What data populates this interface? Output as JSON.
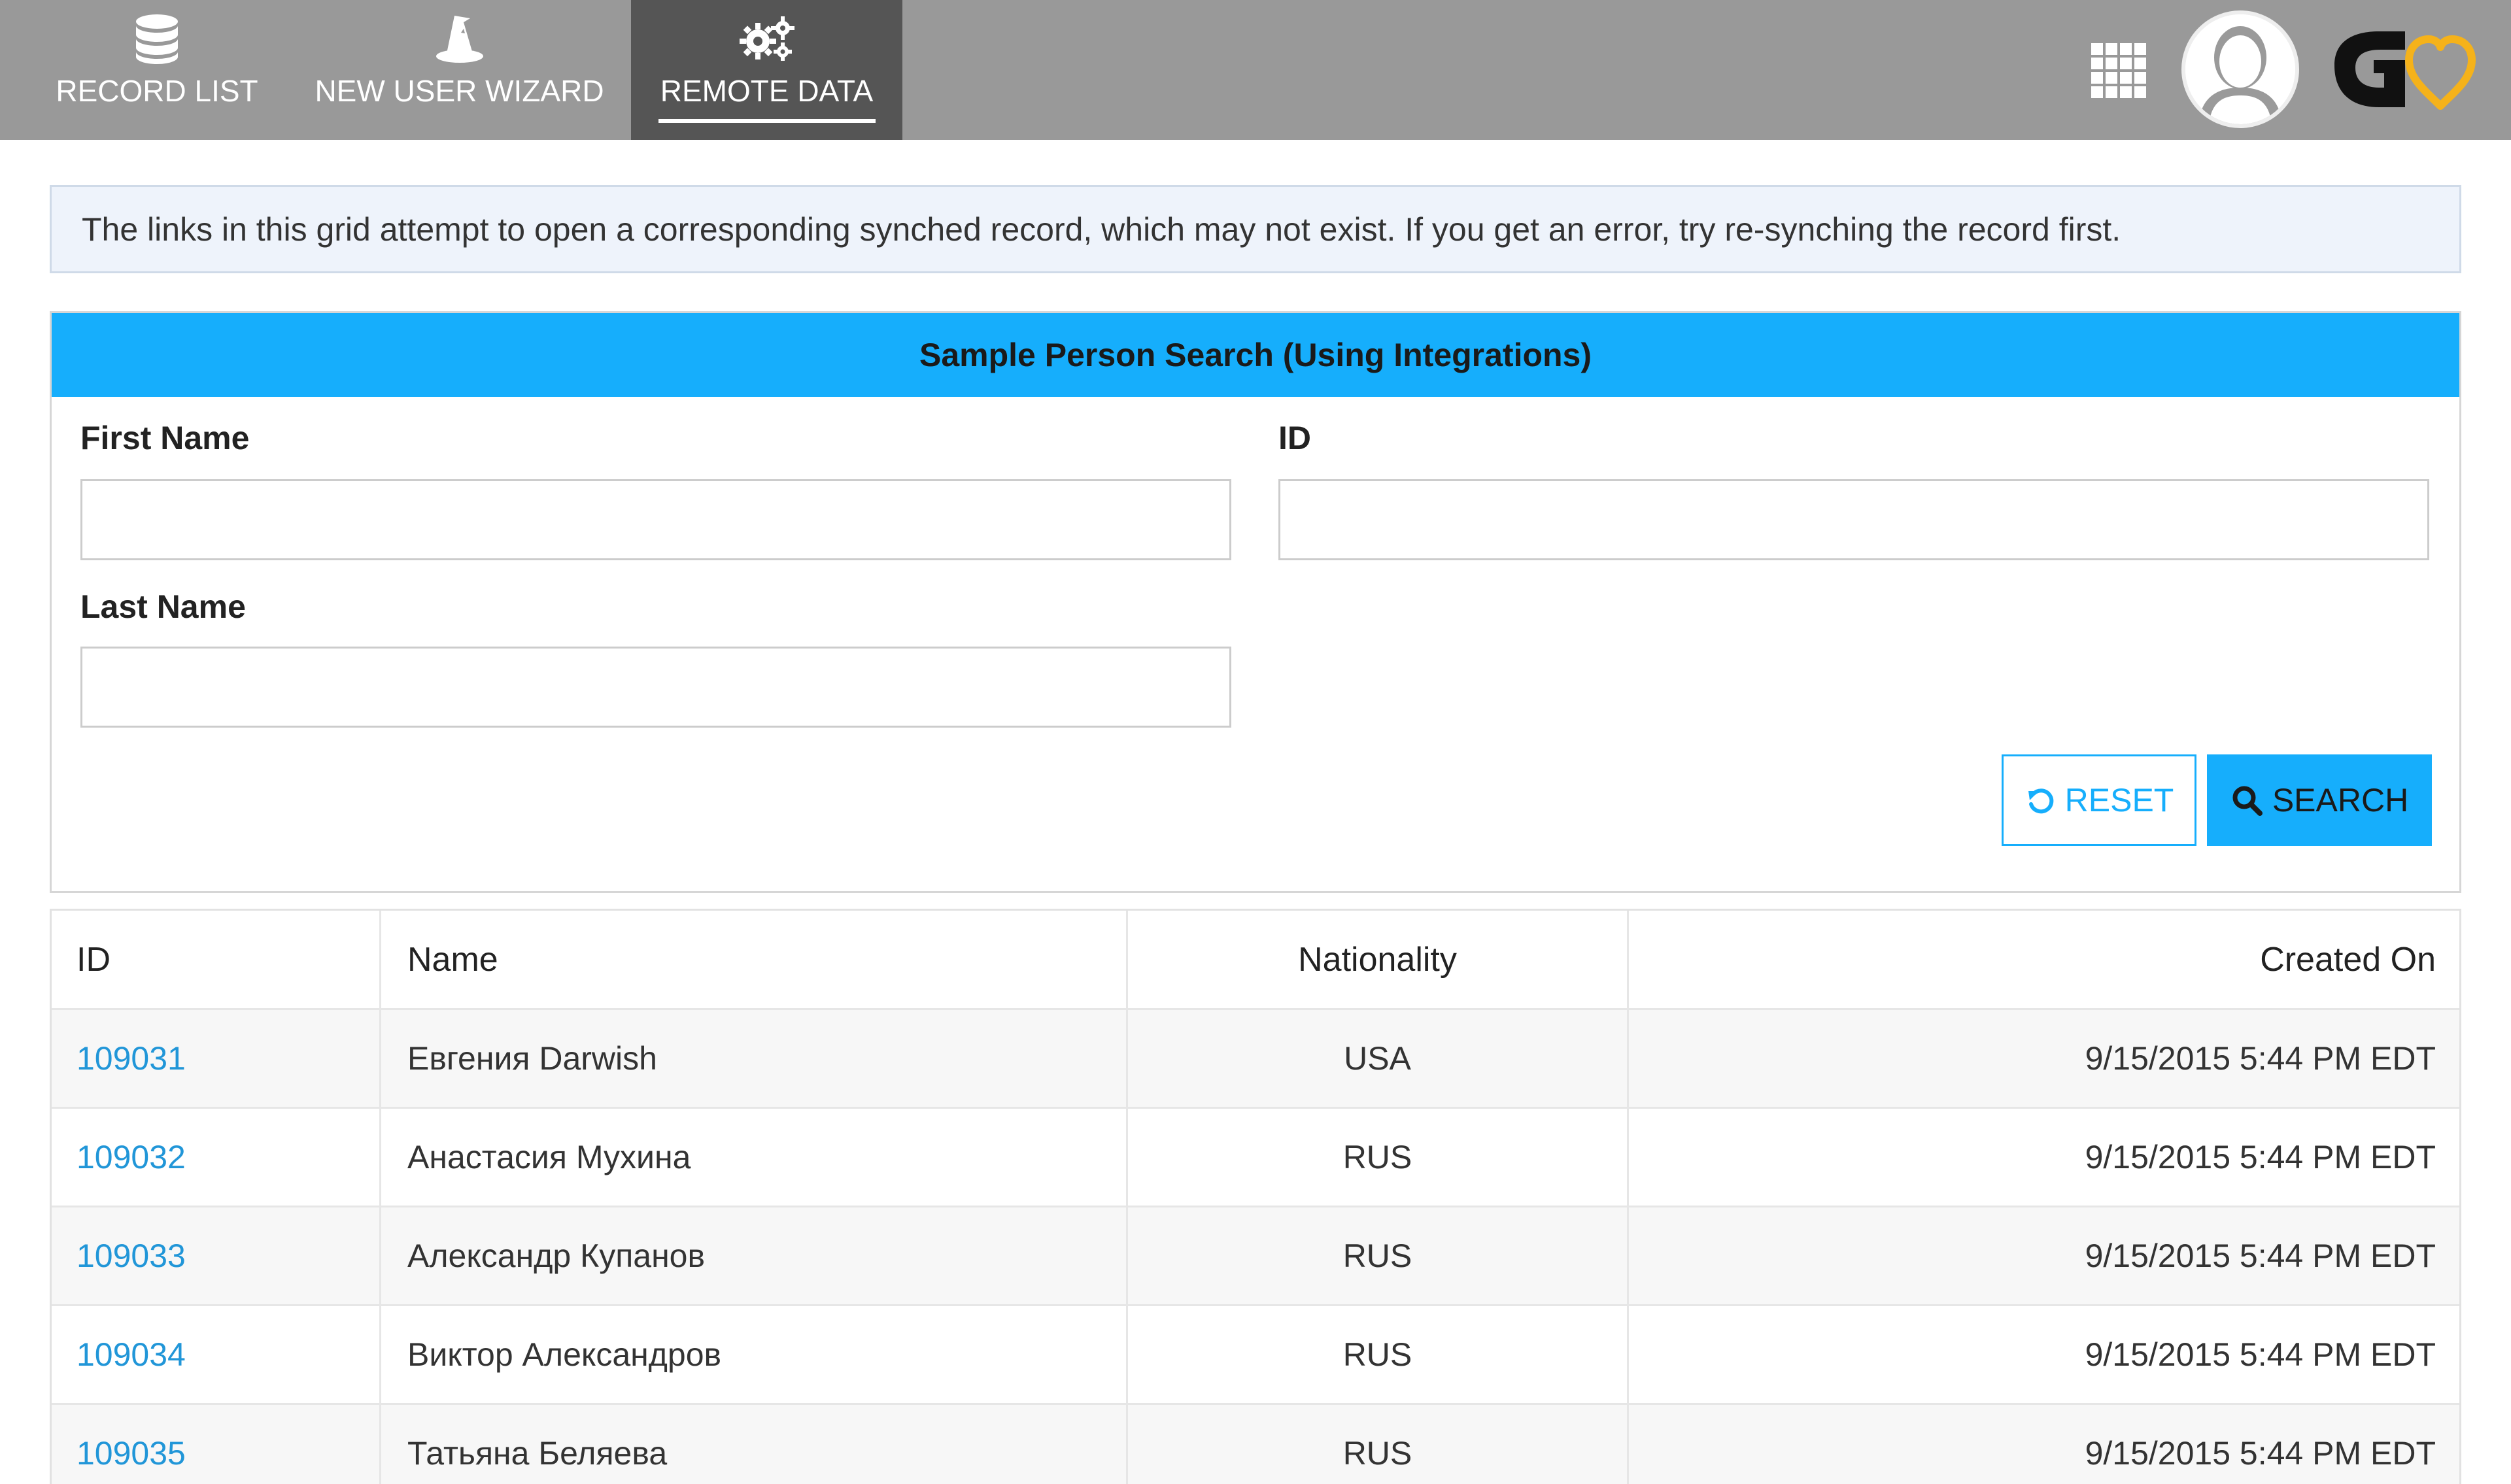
{
  "nav": {
    "tabs": [
      {
        "label": "RECORD LIST",
        "icon": "database-icon"
      },
      {
        "label": "NEW USER WIZARD",
        "icon": "wizard-hat-icon"
      },
      {
        "label": "REMOTE DATA",
        "icon": "gears-icon"
      }
    ],
    "active_tab": "REMOTE DATA",
    "apps_icon": "grid-apps-icon",
    "avatar_icon": "user-avatar-icon",
    "brand_logo": "brand-logo-icon"
  },
  "alert": {
    "text": "The links in this grid attempt to open a corresponding synched record, which may not exist. If you get an error, try re-synching the record first."
  },
  "search_panel": {
    "title": "Sample Person Search (Using Integrations)",
    "first_name": {
      "label": "First Name",
      "value": "",
      "placeholder": ""
    },
    "id_field": {
      "label": "ID",
      "value": "",
      "placeholder": ""
    },
    "last_name": {
      "label": "Last Name",
      "value": "",
      "placeholder": ""
    },
    "reset_label": "RESET",
    "search_label": "SEARCH"
  },
  "grid": {
    "columns": {
      "id": "ID",
      "name": "Name",
      "nationality": "Nationality",
      "created_on": "Created On"
    },
    "rows": [
      {
        "id": "109031",
        "name": "Евгения Darwish",
        "nationality": "USA",
        "created_on": "9/15/2015 5:44 PM EDT"
      },
      {
        "id": "109032",
        "name": "Анастасия Мухина",
        "nationality": "RUS",
        "created_on": "9/15/2015 5:44 PM EDT"
      },
      {
        "id": "109033",
        "name": "Александр Купанов",
        "nationality": "RUS",
        "created_on": "9/15/2015 5:44 PM EDT"
      },
      {
        "id": "109034",
        "name": "Виктор Александров",
        "nationality": "RUS",
        "created_on": "9/15/2015 5:44 PM EDT"
      },
      {
        "id": "109035",
        "name": "Татьяна Беляева",
        "nationality": "RUS",
        "created_on": "9/15/2015 5:44 PM EDT"
      }
    ]
  },
  "colors": {
    "topbar": "#999999",
    "active_tab": "#555555",
    "accent": "#16aefc",
    "link": "#2196d8",
    "alert_bg": "#eef3fb",
    "logo_heart": "#f5b21a"
  }
}
